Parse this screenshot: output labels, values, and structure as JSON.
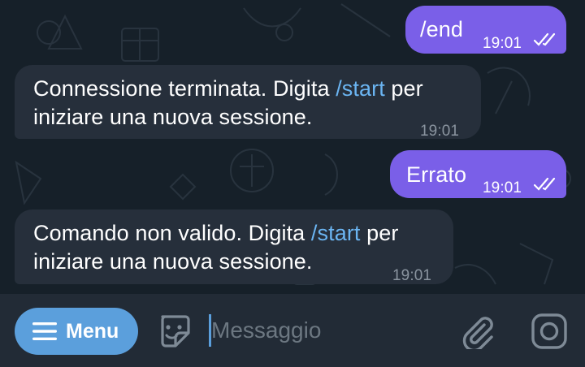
{
  "chat": {
    "messages": [
      {
        "direction": "out",
        "text": "/end",
        "time": "19:01",
        "status": "read"
      },
      {
        "direction": "in",
        "line1_before": "Connessione terminata. Digita ",
        "line1_command": "/start",
        "line1_after": " per",
        "line2": "iniziare una nuova sessione.",
        "time": "19:01"
      },
      {
        "direction": "out",
        "text": "Errato",
        "time": "19:01",
        "status": "read"
      },
      {
        "direction": "in",
        "line1_before": "Comando non valido. Digita ",
        "line1_command": "/start",
        "line1_after": " per",
        "line2": "iniziare una nuova sessione.",
        "time": "19:01"
      }
    ]
  },
  "input_bar": {
    "menu_label": "Menu",
    "menu_icon": "hamburger-icon",
    "sticker_icon": "sticker-icon",
    "placeholder": "Messaggio",
    "attach_icon": "paperclip-icon",
    "camera_icon": "camera-icon"
  },
  "colors": {
    "background": "#162029",
    "incoming_bubble": "#262f3b",
    "outgoing_bubble": "#7a5fe8",
    "command_link": "#6bb5f2",
    "menu_button": "#5b9fdc",
    "input_bar": "#222b36"
  }
}
